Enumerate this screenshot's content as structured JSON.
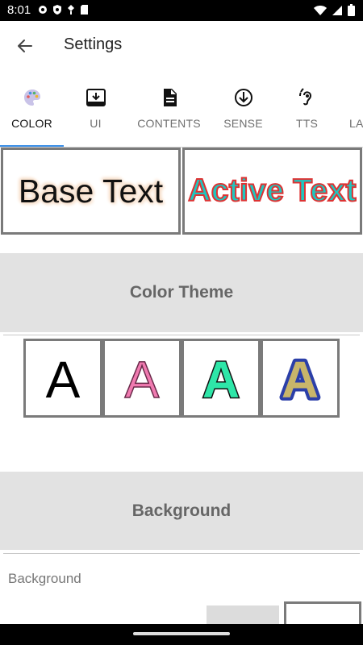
{
  "status_bar": {
    "time": "8:01"
  },
  "app_bar": {
    "title": "Settings"
  },
  "tabs": [
    {
      "label": "COLOR",
      "icon": "palette-icon",
      "active": true
    },
    {
      "label": "UI",
      "icon": "download-box-icon",
      "active": false
    },
    {
      "label": "CONTENTS",
      "icon": "document-icon",
      "active": false
    },
    {
      "label": "SENSE",
      "icon": "arrow-down-circle-icon",
      "active": false
    },
    {
      "label": "TTS",
      "icon": "ear-icon",
      "active": false
    },
    {
      "label": "LA",
      "icon": "",
      "active": false
    }
  ],
  "preview": {
    "base_text": "Base Text",
    "active_text": "Active Text"
  },
  "color_theme": {
    "header": "Color Theme",
    "swatches": [
      {
        "letter": "A",
        "fill": "#000000",
        "stroke": "none"
      },
      {
        "letter": "A",
        "fill": "#f07ab0",
        "stroke": "#6a2a4a"
      },
      {
        "letter": "A",
        "fill": "#2ee6a8",
        "stroke": "#111111"
      },
      {
        "letter": "A",
        "fill": "#c8b56a",
        "stroke": "#2b3fa8"
      }
    ]
  },
  "background": {
    "header": "Background",
    "label": "Background"
  },
  "colors": {
    "accent": "#3a8ee6",
    "section_bg": "#e2e2e2",
    "header_text": "#666666"
  }
}
